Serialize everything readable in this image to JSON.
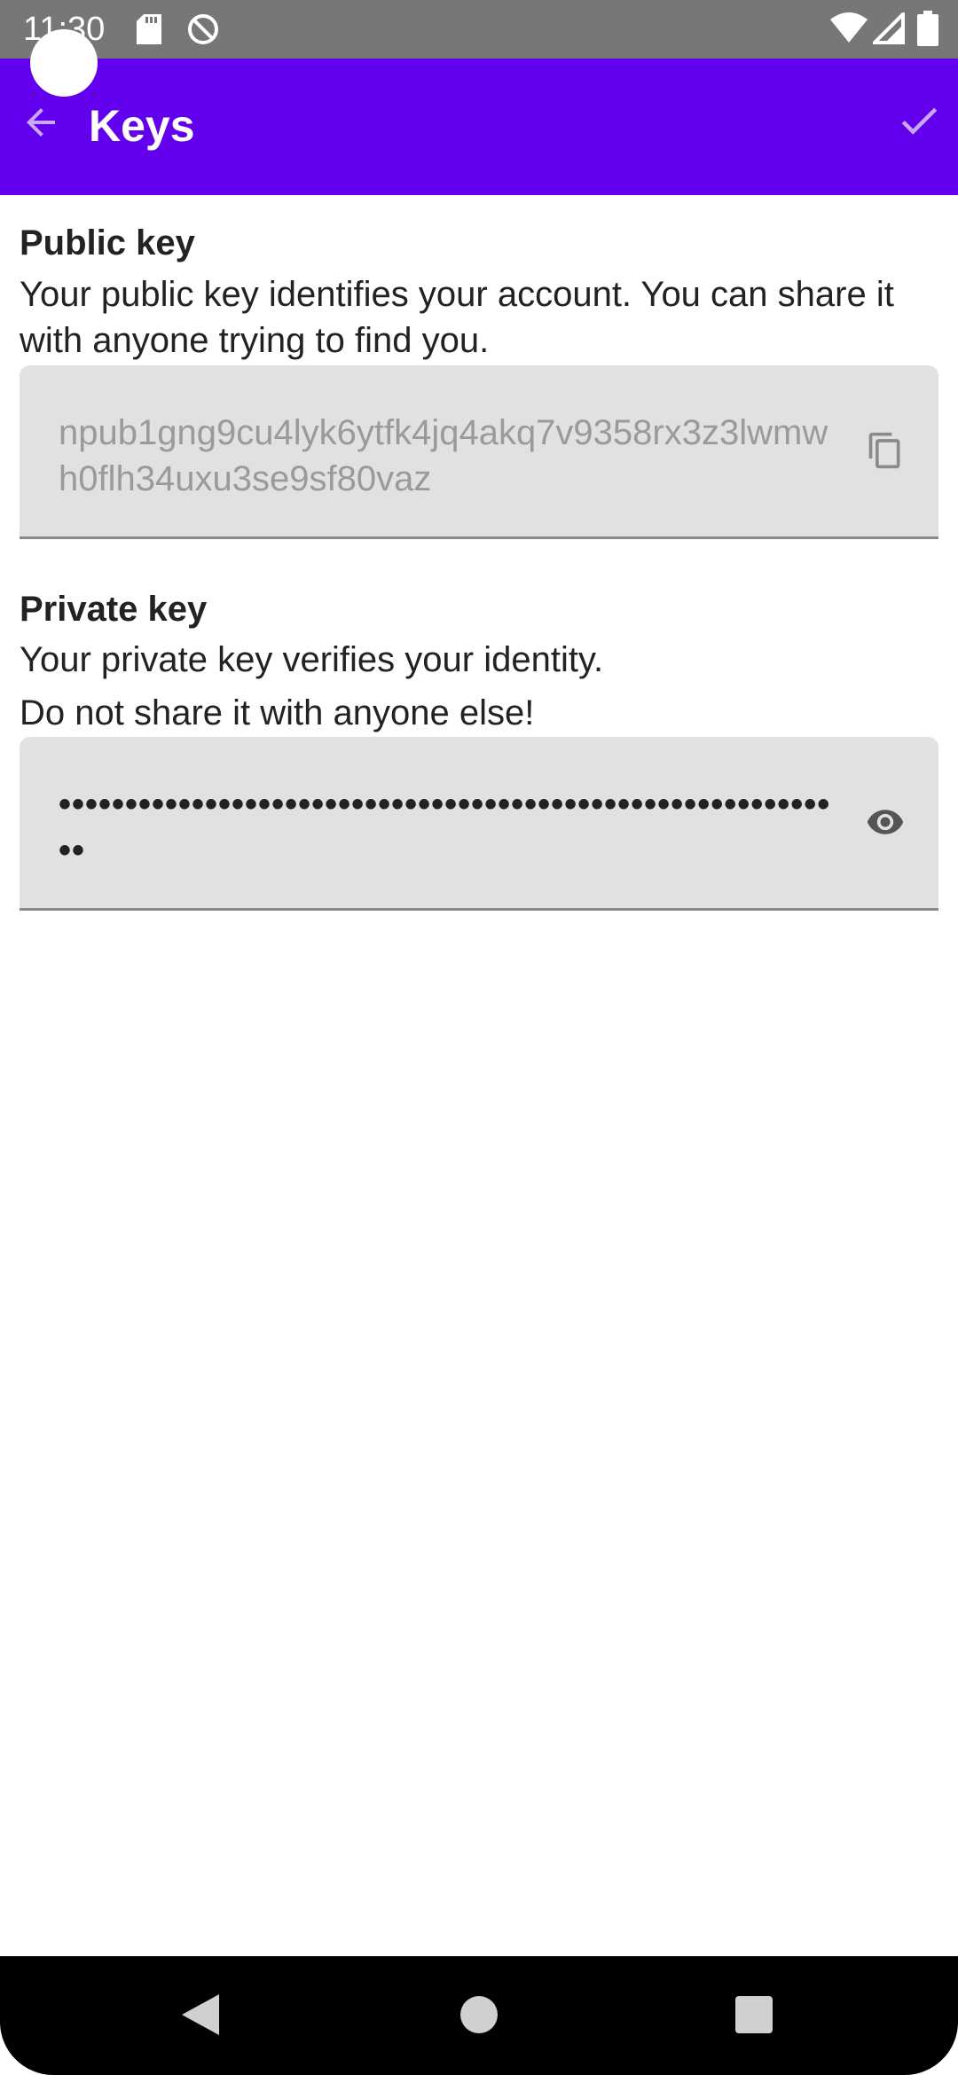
{
  "status_bar": {
    "time": "11:30",
    "icons": [
      "sd-card-icon",
      "no-sync-icon",
      "wifi-icon",
      "signal-icon",
      "battery-icon"
    ]
  },
  "app_bar": {
    "title": "Keys",
    "back_icon": "arrow-back-icon",
    "confirm_icon": "check-icon",
    "background": "#6200ee"
  },
  "public_key": {
    "title": "Public key",
    "description": "Your public key identifies your account. You can share it with anyone trying to find you.",
    "value": "npub1gng9cu4lyk6ytfk4jq4akq7v9358rx3z3lwmwh0flh34uxu3se9sf80vaz",
    "action_icon": "copy-icon"
  },
  "private_key": {
    "title": "Private key",
    "description_line1": "Your private key verifies your identity.",
    "description_line2": "Do not share it with anyone else!",
    "masked_value": "••••••••••••••••••••••••••••••••••••••••••••••••••••••••••••",
    "action_icon": "eye-icon"
  },
  "nav_bar": {
    "back_icon": "nav-back-icon",
    "home_icon": "nav-home-icon",
    "recents_icon": "nav-recents-icon"
  }
}
